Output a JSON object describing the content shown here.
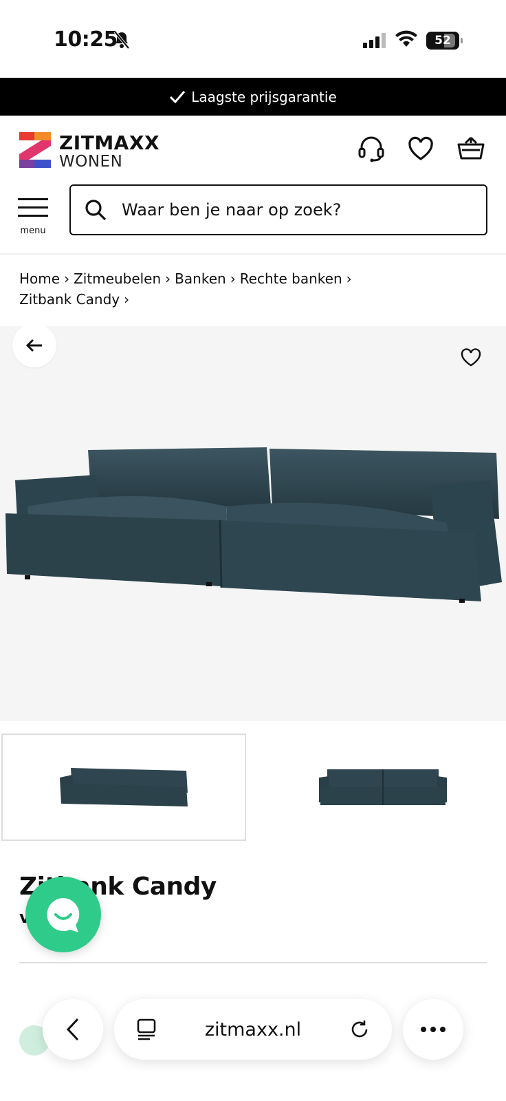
{
  "status": {
    "time": "10:25",
    "battery": "52"
  },
  "promo": {
    "text": "Laagste prijsgarantie"
  },
  "logo": {
    "line1": "ZITMAXX",
    "line2": "WONEN"
  },
  "menu": {
    "label": "menu"
  },
  "search": {
    "placeholder": "Waar ben je naar op zoek?"
  },
  "breadcrumb": [
    "Home",
    "Zitmeubelen",
    "Banken",
    "Rechte banken",
    "Zitbank Candy"
  ],
  "product": {
    "title": "Zitbank Candy",
    "price": "v…,-"
  },
  "browser": {
    "url": "zitmaxx.nl"
  },
  "colors": {
    "accent_green": "#2fcb8a",
    "sofa": "#2f4650",
    "brand_red": "#e63b2e",
    "brand_orange": "#f28c28",
    "brand_purple": "#7b3fa0"
  }
}
